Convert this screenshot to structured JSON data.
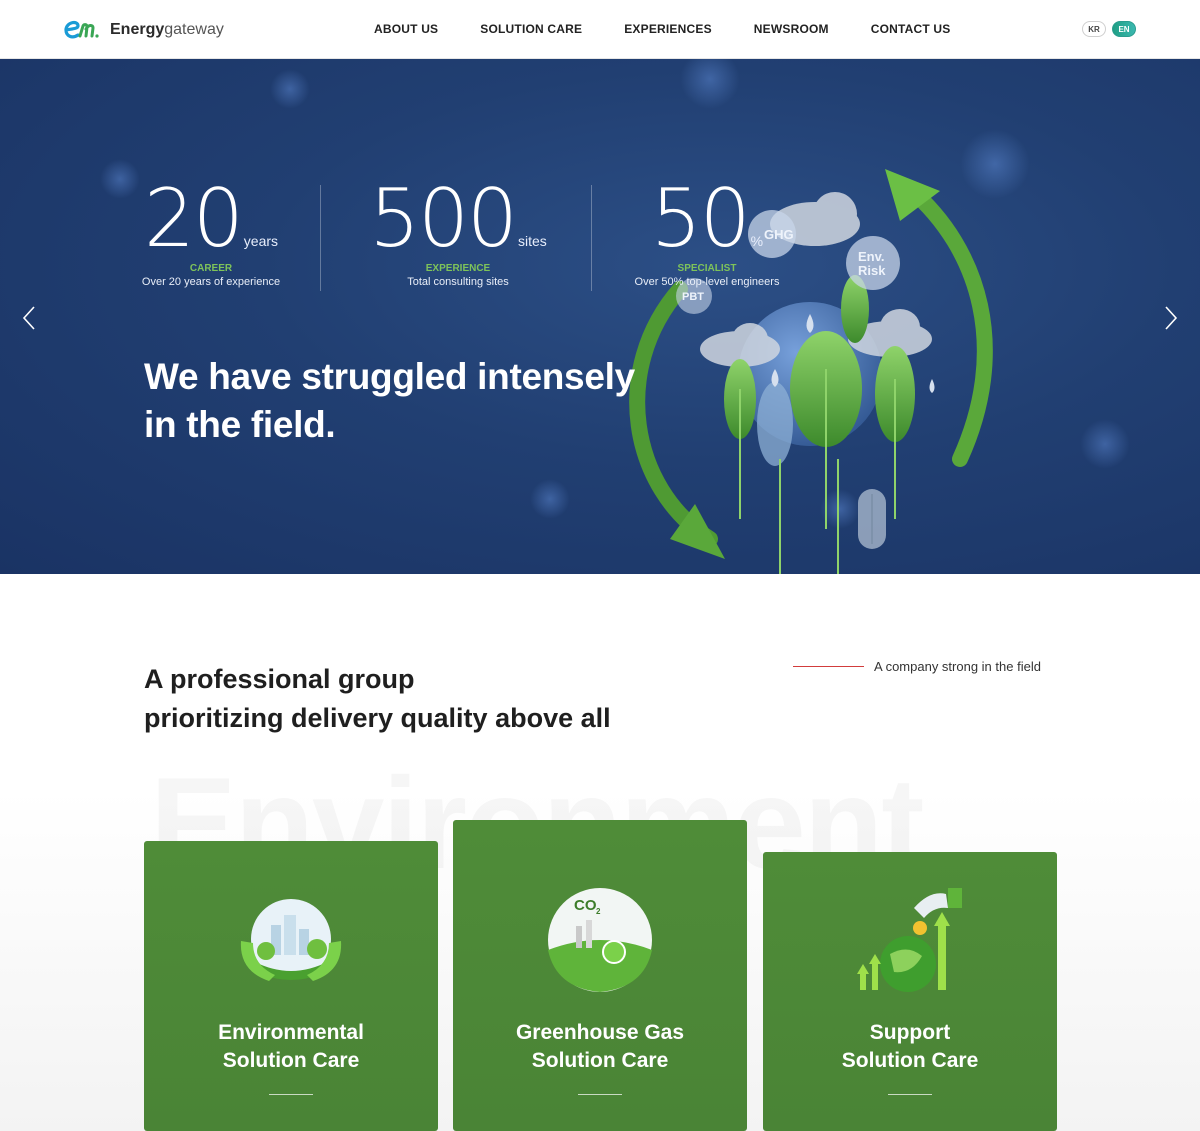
{
  "header": {
    "logo_brand": "Energy",
    "logo_sub": "gateway",
    "nav": [
      "ABOUT US",
      "SOLUTION CARE",
      "EXPERIENCES",
      "NEWSROOM",
      "CONTACT US"
    ],
    "lang": {
      "kr": "KR",
      "en": "EN",
      "active": "EN"
    }
  },
  "hero": {
    "stats": [
      {
        "num": "20",
        "unit": "years",
        "label": "CAREER",
        "desc": "Over 20 years of experience"
      },
      {
        "num": "500",
        "unit": "sites",
        "label": "EXPERIENCE",
        "desc": "Total consulting sites"
      },
      {
        "num": "50",
        "unit": "%",
        "label": "SPECIALIST",
        "desc": "Over 50% top-level engineers"
      }
    ],
    "title_line1": "We have struggled intensely",
    "title_line2": "in the field.",
    "bubbles": {
      "ghg": "GHG",
      "env1": "Env.",
      "env2": "Risk",
      "pbt": "PBT"
    }
  },
  "section": {
    "title_line1": "A professional group",
    "title_line2": "prioritizing delivery quality above all",
    "tagline": "A company strong in the field",
    "bg_text": "Environment"
  },
  "cards": [
    {
      "line1": "Environmental",
      "line2": "Solution Care",
      "icon": "globe-hands-icon"
    },
    {
      "line1": "Greenhouse Gas",
      "line2": "Solution Care",
      "icon": "co2-globe-icon",
      "co2": "CO",
      "sub": "2"
    },
    {
      "line1": "Support",
      "line2": "Solution Care",
      "icon": "growth-globe-icon"
    }
  ],
  "colors": {
    "accent_green": "#7ec35a",
    "card_green": "#4f8c38",
    "hero_blue": "#213f72",
    "tag_red": "#d23c3c",
    "lang_active": "#2a9d8f"
  }
}
